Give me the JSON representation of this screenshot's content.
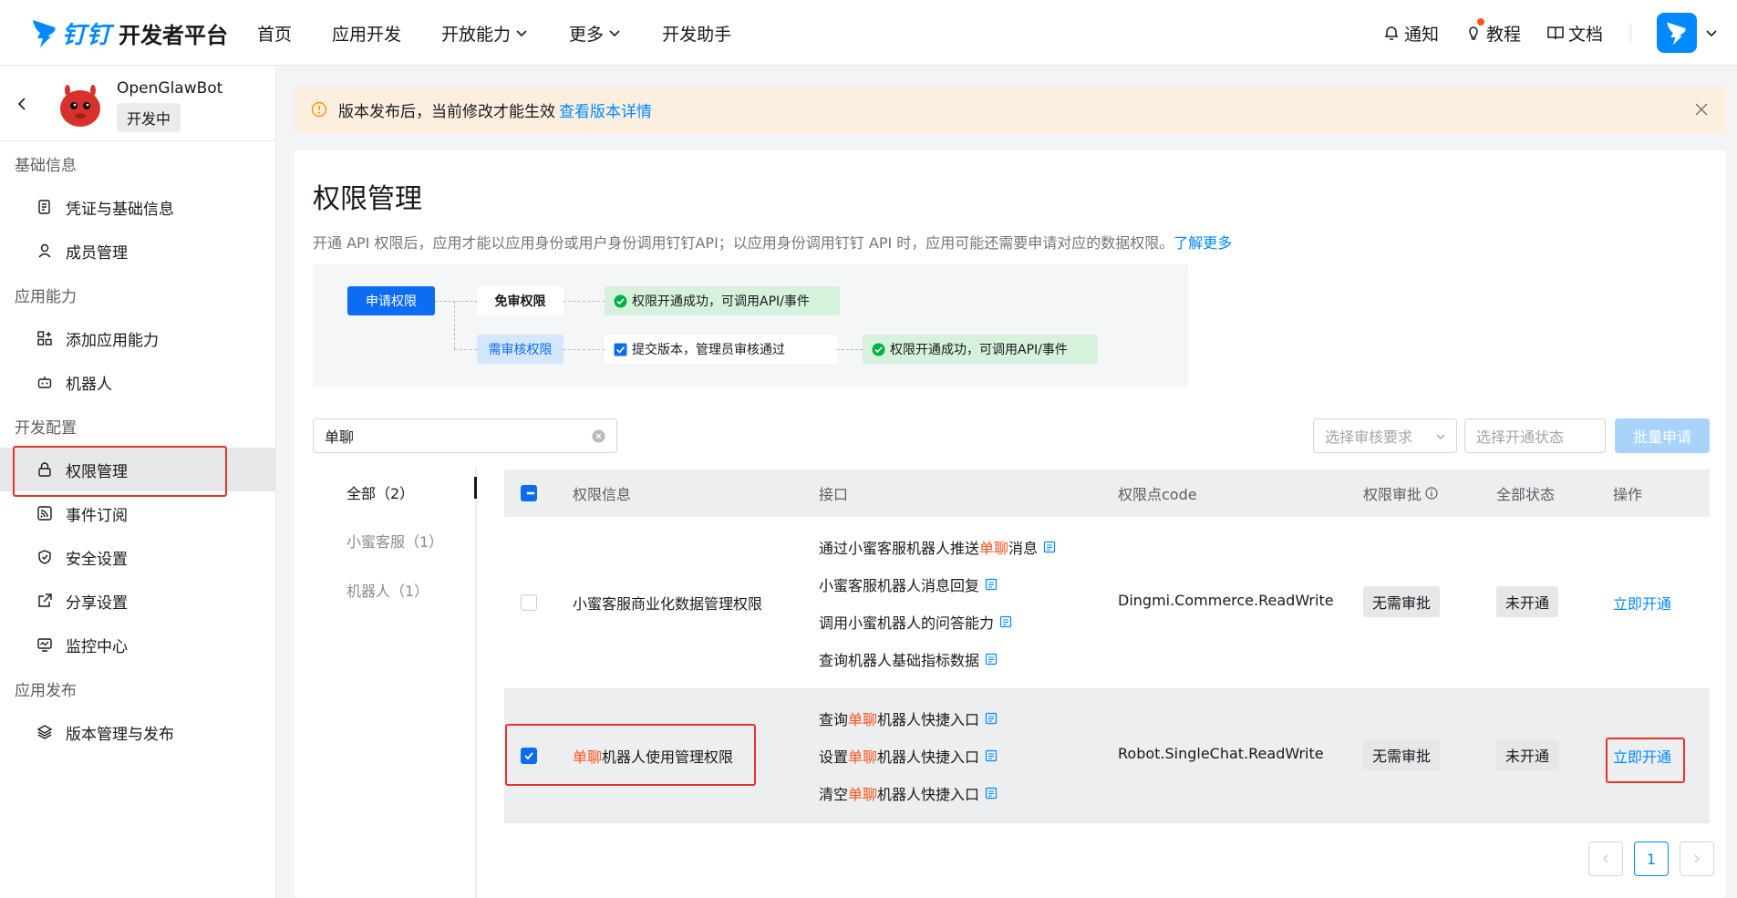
{
  "header": {
    "logo_mark": "钉钉",
    "logo_text": "开发者平台",
    "nav": [
      {
        "label": "首页"
      },
      {
        "label": "应用开发"
      },
      {
        "label": "开放能力"
      },
      {
        "label": "更多"
      },
      {
        "label": "开发助手"
      }
    ],
    "notify_label": "通知",
    "tutorial_label": "教程",
    "docs_label": "文档"
  },
  "sidebar": {
    "app_name": "OpenGlawBot",
    "app_status": "开发中",
    "sections": [
      {
        "title": "基础信息",
        "items": [
          {
            "label": "凭证与基础信息",
            "icon": "credential-icon"
          },
          {
            "label": "成员管理",
            "icon": "member-icon"
          }
        ]
      },
      {
        "title": "应用能力",
        "items": [
          {
            "label": "添加应用能力",
            "icon": "grid-add-icon"
          },
          {
            "label": "机器人",
            "icon": "robot-icon"
          }
        ]
      },
      {
        "title": "开发配置",
        "items": [
          {
            "label": "权限管理",
            "icon": "lock-icon"
          },
          {
            "label": "事件订阅",
            "icon": "rss-icon"
          },
          {
            "label": "安全设置",
            "icon": "shield-icon"
          },
          {
            "label": "分享设置",
            "icon": "share-icon"
          },
          {
            "label": "监控中心",
            "icon": "monitor-icon"
          }
        ]
      },
      {
        "title": "应用发布",
        "items": [
          {
            "label": "版本管理与发布",
            "icon": "layers-icon"
          }
        ]
      }
    ]
  },
  "notice": {
    "text": "版本发布后，当前修改才能生效",
    "link": "查看版本详情"
  },
  "page": {
    "title": "权限管理",
    "desc": "开通 API 权限后，应用才能以应用身份或用户身份调用钉钉API；以应用身份调用钉钉 API 时，应用可能还需要申请对应的数据权限。",
    "learn_more": "了解更多"
  },
  "flow": {
    "apply": "申请权限",
    "free": "免审权限",
    "ok1": "权限开通成功，可调用API/事件",
    "review": "需审核权限",
    "submit": "提交版本，管理员审核通过",
    "ok2": "权限开通成功，可调用API/事件"
  },
  "filters": {
    "search_value": "单聊",
    "review_placeholder": "选择审核要求",
    "status_placeholder": "选择开通状态",
    "batch_label": "批量申请"
  },
  "categories": [
    {
      "label": "全部（2）",
      "active": true
    },
    {
      "label": "小蜜客服（1）",
      "active": false
    },
    {
      "label": "机器人（1）",
      "active": false
    }
  ],
  "table": {
    "headers": [
      "权限信息",
      "接口",
      "权限点code",
      "权限审批",
      "全部状态",
      "操作"
    ],
    "rows": [
      {
        "checked": false,
        "name_parts": [
          "",
          "小蜜客服商业化数据管理权限"
        ],
        "apis": [
          [
            "通过小蜜客服机器人推送",
            "单聊",
            "消息"
          ],
          [
            "小蜜客服机器人消息回复",
            "",
            ""
          ],
          [
            "调用小蜜机器人的问答能力",
            "",
            ""
          ],
          [
            "查询机器人基础指标数据",
            "",
            ""
          ]
        ],
        "code": "Dingmi.Commerce.ReadWrite",
        "approval": "无需审批",
        "status": "未开通",
        "action": "立即开通"
      },
      {
        "checked": true,
        "name_parts": [
          "单聊",
          "机器人使用管理权限"
        ],
        "apis": [
          [
            "查询",
            "单聊",
            "机器人快捷入口"
          ],
          [
            "设置",
            "单聊",
            "机器人快捷入口"
          ],
          [
            "清空",
            "单聊",
            "机器人快捷入口"
          ]
        ],
        "code": "Robot.SingleChat.ReadWrite",
        "approval": "无需审批",
        "status": "未开通",
        "action": "立即开通"
      }
    ]
  },
  "pagination": {
    "current": "1"
  },
  "colors": {
    "accent": "#0089ff",
    "highlight": "#ff5219",
    "annotation": "#e8332c"
  }
}
